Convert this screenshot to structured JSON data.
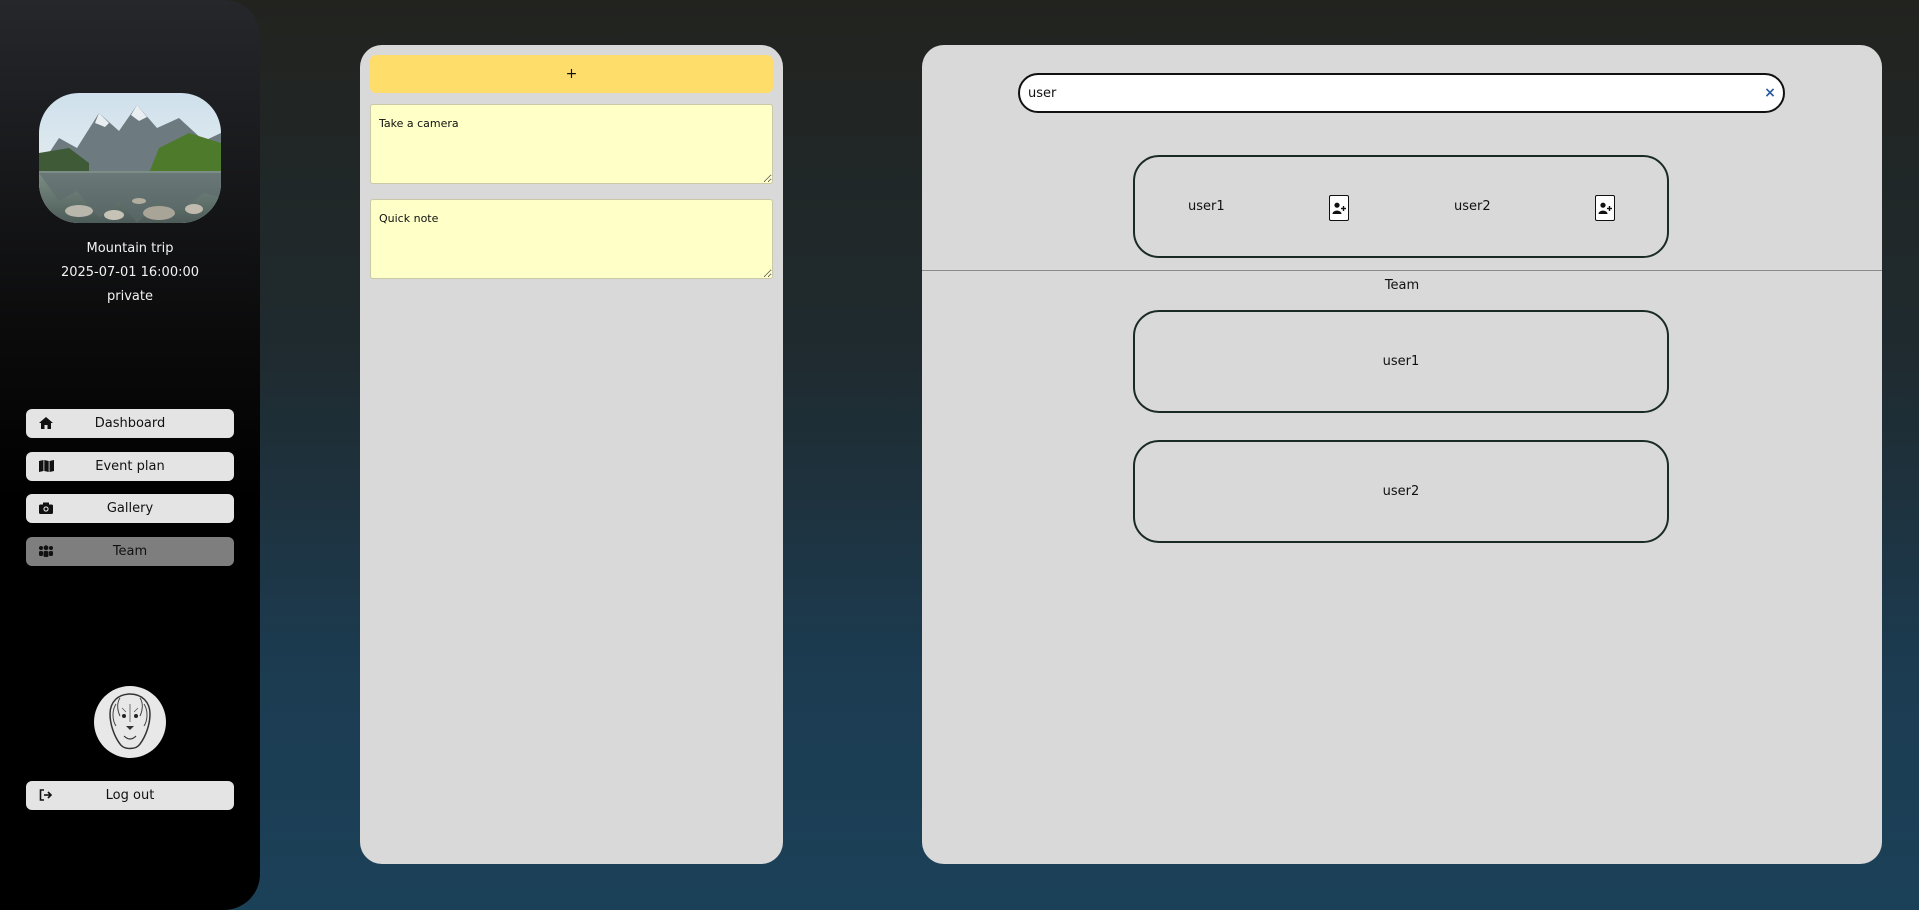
{
  "event": {
    "name": "Mountain trip",
    "datetime": "2025-07-01 16:00:00",
    "visibility": "private"
  },
  "nav": [
    {
      "label": "Dashboard",
      "icon": "home-icon"
    },
    {
      "label": "Event plan",
      "icon": "map-icon"
    },
    {
      "label": "Gallery",
      "icon": "camera-icon"
    },
    {
      "label": "Team",
      "icon": "users-icon",
      "active": true
    }
  ],
  "logout": {
    "label": "Log out",
    "icon": "logout-icon"
  },
  "notes": {
    "add_label": "+",
    "items": [
      "Take a camera",
      "Quick note"
    ]
  },
  "search": {
    "value": "user",
    "clear_label": "×"
  },
  "search_results": [
    "user1",
    "user2"
  ],
  "team": {
    "label": "Team",
    "members": [
      "user1",
      "user2"
    ]
  },
  "colors": {
    "accent_yellow": "#ffdd6a",
    "note_bg": "#ffffc8",
    "panel_bg": "#d9d9d9",
    "nav_active": "#7e7e7e"
  }
}
